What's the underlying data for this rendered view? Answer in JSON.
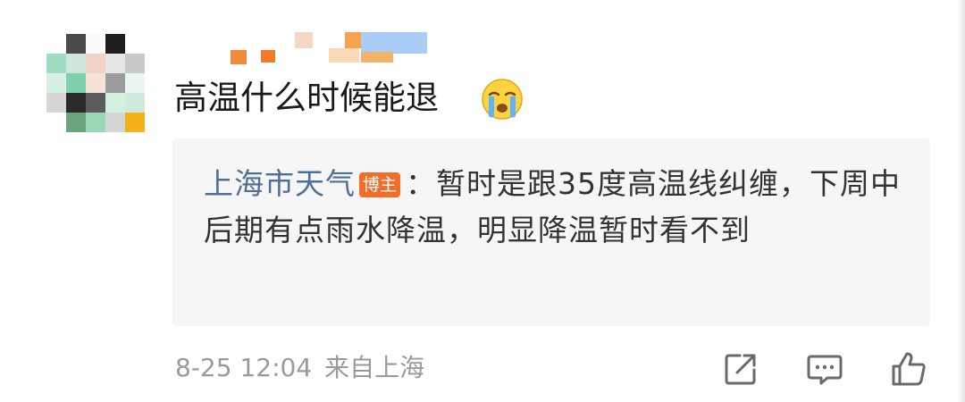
{
  "comment": {
    "text": "高温什么时候能退",
    "emoji": "crying-face"
  },
  "reply": {
    "author": "上海市天气",
    "badge": "博主",
    "body": "：暂时是跟35度高温线纠缠，下周中后期有点雨水降温，明显降温暂时看不到"
  },
  "meta": {
    "timestamp": "8-25 12:04",
    "location": "来自上海"
  },
  "actions": {
    "share_icon": "share-icon",
    "comment_icon": "comment-icon",
    "like_icon": "thumbs-up-icon"
  },
  "colors": {
    "reply_author": "#4d6f98",
    "badge_bg": "#f46c29",
    "reply_bg": "#f6f6f6",
    "meta_text": "#9a9a9a",
    "comment_text": "#1a1a1a"
  }
}
